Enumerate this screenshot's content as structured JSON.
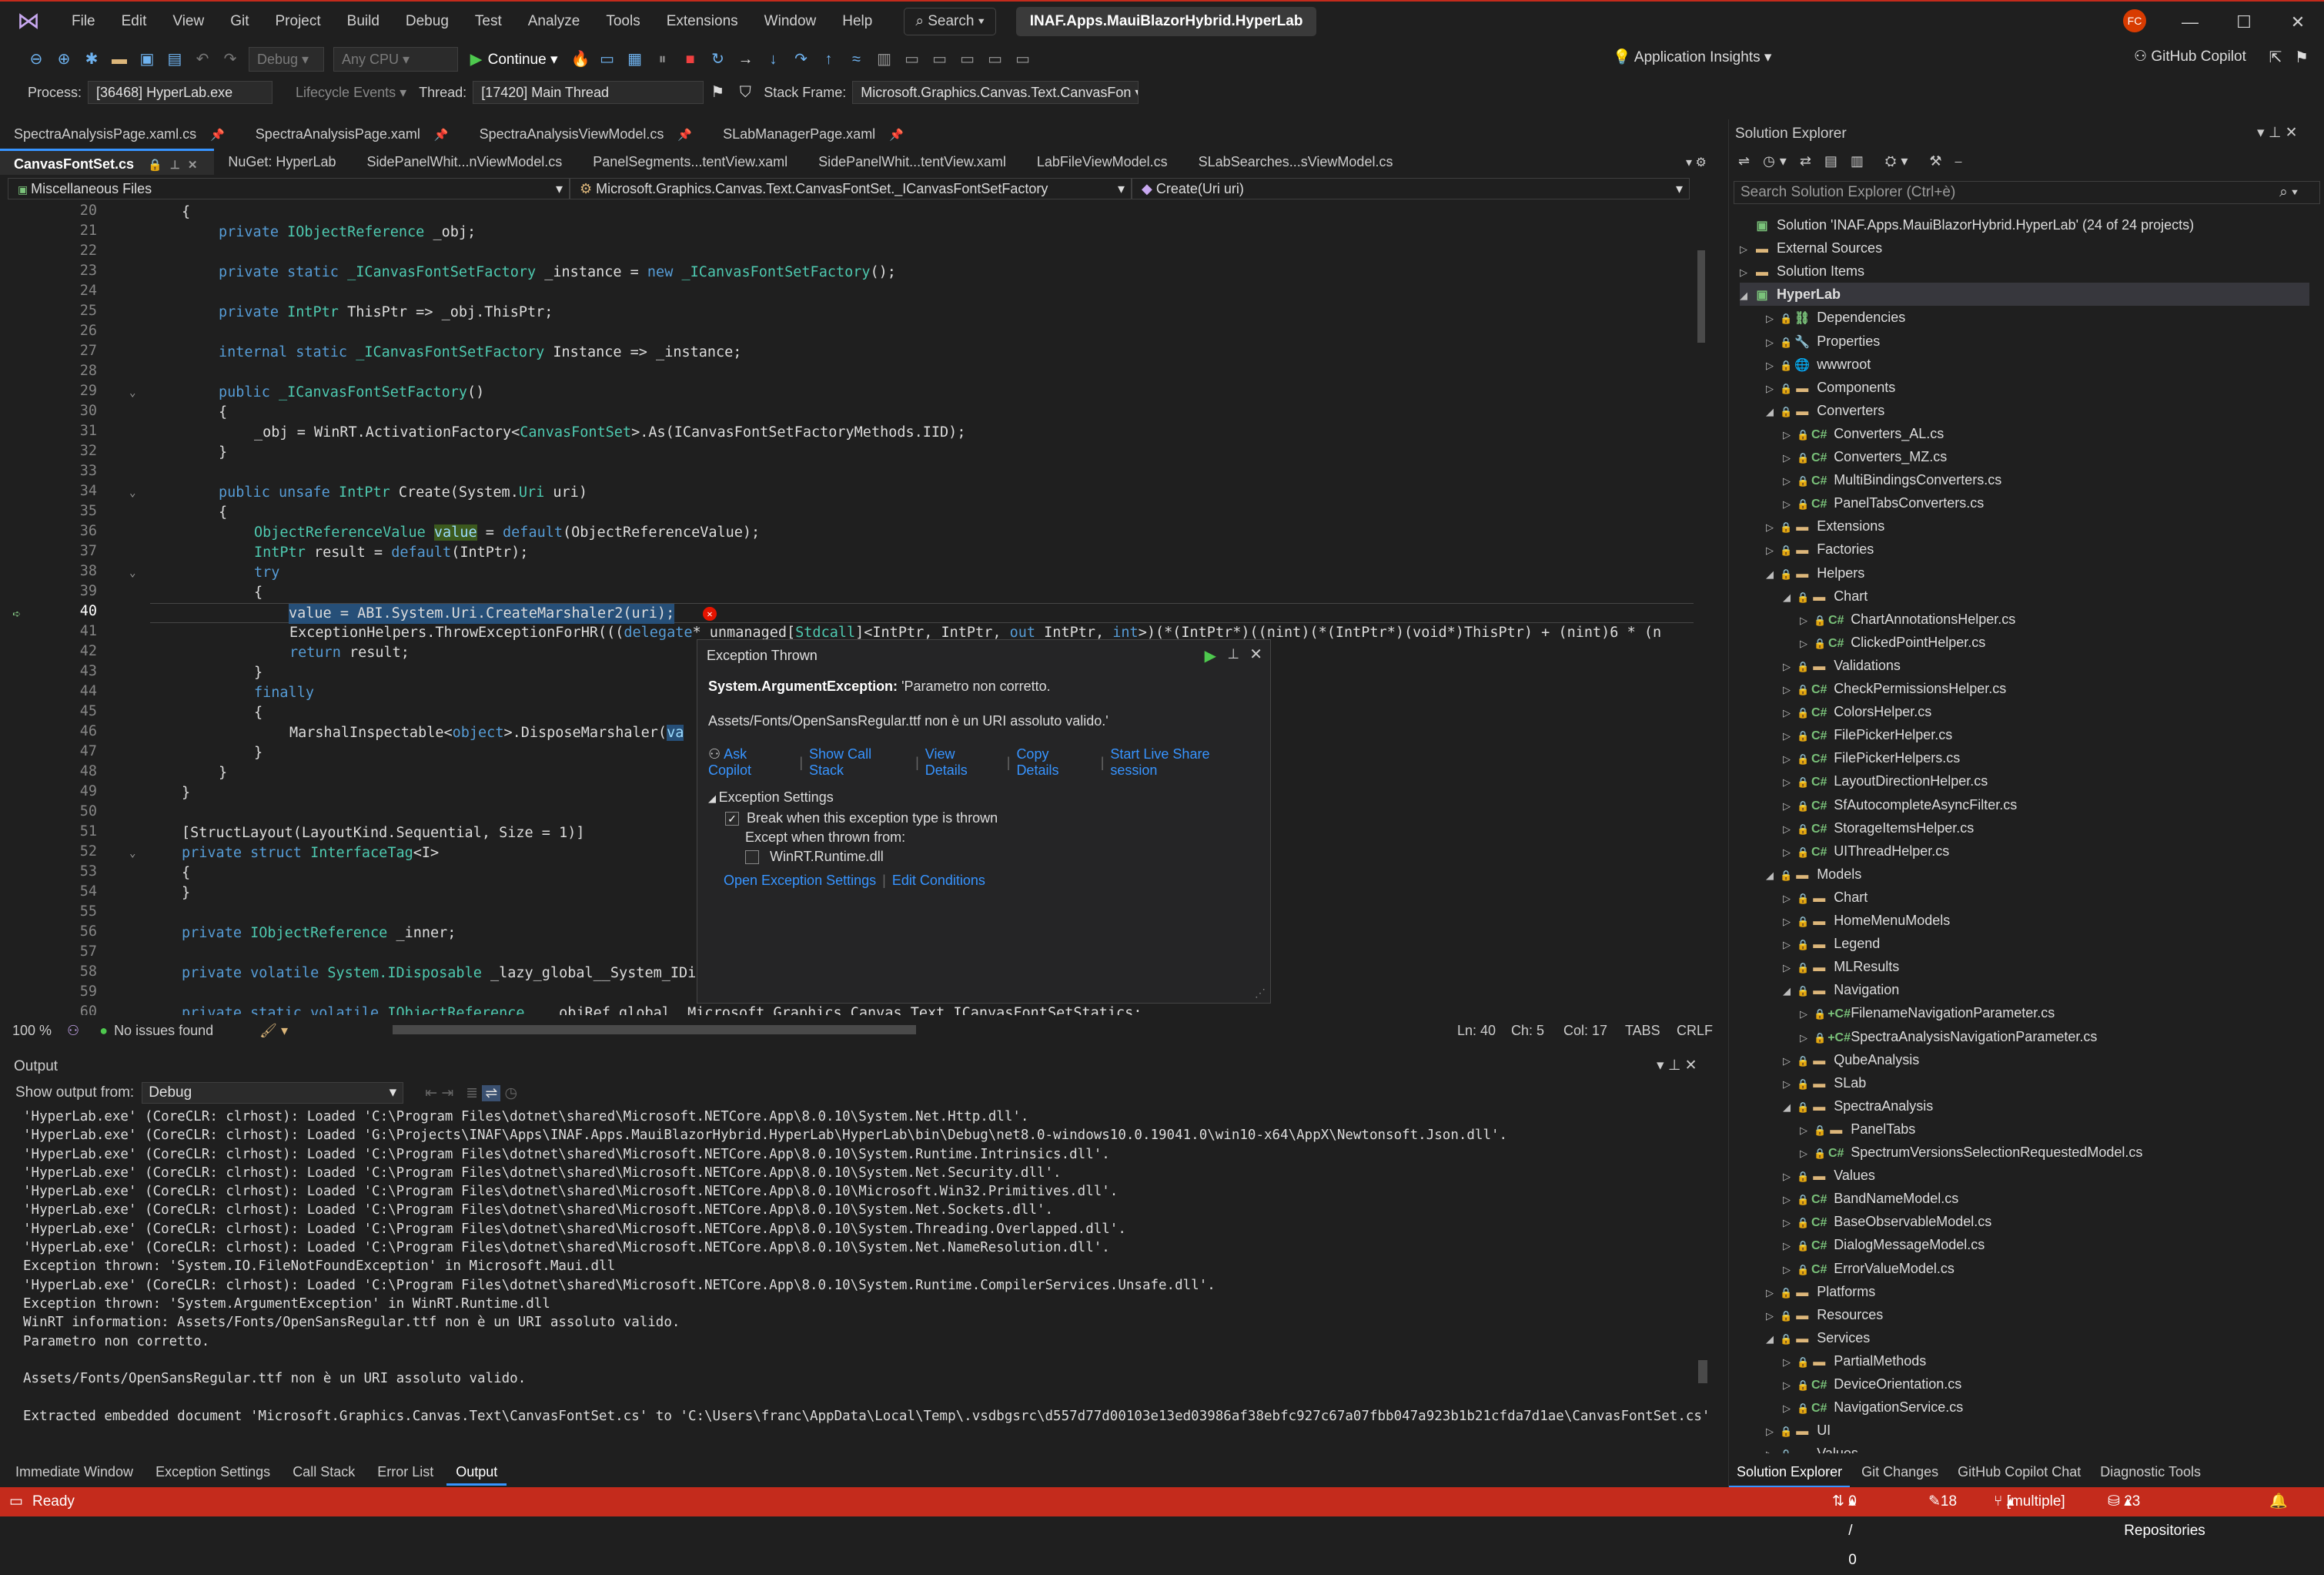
{
  "menu": {
    "items": [
      "File",
      "Edit",
      "View",
      "Git",
      "Project",
      "Build",
      "Debug",
      "Test",
      "Analyze",
      "Tools",
      "Extensions",
      "Window",
      "Help"
    ],
    "search": "Search",
    "solution_title": "INAF.Apps.MauiBlazorHybrid.HyperLab",
    "avatar": "FC"
  },
  "toolbar": {
    "config": "Debug",
    "platform": "Any CPU",
    "continue": "Continue",
    "app_insights": "Application Insights",
    "copilot": "GitHub Copilot"
  },
  "debugbar": {
    "process_label": "Process:",
    "process": "[36468] HyperLab.exe",
    "lifecycle": "Lifecycle Events",
    "thread_label": "Thread:",
    "thread": "[17420] Main Thread",
    "stack_label": "Stack Frame:",
    "stack": "Microsoft.Graphics.Canvas.Text.CanvasFon"
  },
  "tabs_row1": [
    "SpectraAnalysisPage.xaml.cs",
    "SpectraAnalysisPage.xaml",
    "SpectraAnalysisViewModel.cs",
    "SLabManagerPage.xaml"
  ],
  "tabs_row2": [
    "CanvasFontSet.cs",
    "NuGet: HyperLab",
    "SidePanelWhit...nViewModel.cs",
    "PanelSegments...tentView.xaml",
    "SidePanelWhit...tentView.xaml",
    "LabFileViewModel.cs",
    "SLabSearches...sViewModel.cs"
  ],
  "navbar": {
    "project": "Miscellaneous Files",
    "type": "Microsoft.Graphics.Canvas.Text.CanvasFontSet._ICanvasFontSetFactory",
    "member": "Create(Uri uri)"
  },
  "code": {
    "l20": "{",
    "l21a": "private ",
    "l21b": "IObjectReference",
    "l21c": " _obj;",
    "l23a": "private static ",
    "l23b": "_ICanvasFontSetFactory",
    "l23c": " _instance = ",
    "l23d": "new ",
    "l23e": "_ICanvasFontSetFactory",
    "l23f": "();",
    "l25a": "private ",
    "l25b": "IntPtr",
    "l25c": " ThisPtr => _obj.ThisPtr;",
    "l27a": "internal static ",
    "l27b": "_ICanvasFontSetFactory",
    "l27c": " Instance => _instance;",
    "l29a": "public ",
    "l29b": "_ICanvasFontSetFactory",
    "l29c": "()",
    "l30": "{",
    "l31a": "_obj = WinRT.ActivationFactory<",
    "l31b": "CanvasFontSet",
    "l31c": ">.As(ICanvasFontSetFactoryMethods.IID);",
    "l32": "}",
    "l34a": "public unsafe ",
    "l34b": "IntPtr",
    "l34c": " Create(System.",
    "l34d": "Uri",
    "l34e": " uri)",
    "l35": "{",
    "l36a": "ObjectReferenceValue ",
    "l36b": "value",
    "l36c": " = ",
    "l36d": "default",
    "l36e": "(ObjectReferenceValue);",
    "l37a": "IntPtr",
    "l37b": " result = ",
    "l37c": "default",
    "l37d": "(IntPtr);",
    "l38": "try",
    "l39": "{",
    "l40": "value = ABI.System.Uri.CreateMarshaler2(uri);",
    "l41a": "ExceptionHelpers.ThrowExceptionForHR(((",
    "l41b": "delegate",
    "l41c": "* unmanaged[",
    "l41d": "Stdcall",
    "l41e": "]<IntPtr, IntPtr, ",
    "l41f": "out",
    "l41g": " IntPtr, ",
    "l41h": "int",
    "l41i": ">)(*(IntPtr*)((nint)(*(IntPtr*)(void*)ThisPtr) + (nint)6 * (n",
    "l42a": "return ",
    "l42b": "result;",
    "l43": "}",
    "l44": "finally",
    "l45": "{",
    "l46a": "MarshalInspectable<",
    "l46b": "object",
    "l46c": ">.DisposeMarshaler(",
    "l46d": "va",
    "l47": "}",
    "l48": "}",
    "l49": "}",
    "l51a": "[StructLayout(LayoutKind.Sequential, Size = 1)]",
    "l52a": "private struct ",
    "l52b": "InterfaceTag",
    "l52c": "<I>",
    "l53": "{",
    "l54": "}",
    "l56a": "private ",
    "l56b": "IObjectReference",
    "l56c": " _inner;",
    "l58a": "private volatile ",
    "l58b": "System.IDisposable",
    "l58c": " _lazy_global__System_IDisposable;",
    "l60a": "private static volatile ",
    "l60b": "IObjectReference",
    "l60c": " ___objRef_global__Microsoft_Graphics_Canvas_Text_ICanvasFontSetStatics;"
  },
  "line_numbers": [
    "20",
    "21",
    "22",
    "23",
    "24",
    "25",
    "26",
    "27",
    "28",
    "29",
    "30",
    "31",
    "32",
    "33",
    "34",
    "35",
    "36",
    "37",
    "38",
    "39",
    "40",
    "41",
    "42",
    "43",
    "44",
    "45",
    "46",
    "47",
    "48",
    "49",
    "50",
    "51",
    "52",
    "53",
    "54",
    "55",
    "56",
    "57",
    "58",
    "59",
    "60"
  ],
  "popup": {
    "title": "Exception Thrown",
    "exception_type": "System.ArgumentException:",
    "exception_msg": "'Parametro non corretto.",
    "detail": "Assets/Fonts/OpenSansRegular.ttf non è un URI assoluto valido.'",
    "ask_copilot": "Ask Copilot",
    "show_call_stack": "Show Call Stack",
    "view_details": "View Details",
    "copy_details": "Copy Details",
    "live_share": "Start Live Share session",
    "settings_header": "Exception Settings",
    "break_when": "Break when this exception type is thrown",
    "except_when": "Except when thrown from:",
    "winrt": "WinRT.Runtime.dll",
    "open_settings": "Open Exception Settings",
    "edit_conditions": "Edit Conditions"
  },
  "editor_status": {
    "zoom": "100 %",
    "issues": "No issues found",
    "ln": "Ln: 40",
    "ch": "Ch: 5",
    "col": "Col: 17",
    "tabs": "TABS",
    "crlf": "CRLF"
  },
  "output": {
    "title": "Output",
    "show_from": "Show output from:",
    "source": "Debug",
    "lines": [
      "'HyperLab.exe' (CoreCLR: clrhost): Loaded 'C:\\Program Files\\dotnet\\shared\\Microsoft.NETCore.App\\8.0.10\\System.Net.Http.dll'.",
      "'HyperLab.exe' (CoreCLR: clrhost): Loaded 'G:\\Projects\\INAF\\Apps\\INAF.Apps.MauiBlazorHybrid.HyperLab\\HyperLab\\bin\\Debug\\net8.0-windows10.0.19041.0\\win10-x64\\AppX\\Newtonsoft.Json.dll'.",
      "'HyperLab.exe' (CoreCLR: clrhost): Loaded 'C:\\Program Files\\dotnet\\shared\\Microsoft.NETCore.App\\8.0.10\\System.Runtime.Intrinsics.dll'.",
      "'HyperLab.exe' (CoreCLR: clrhost): Loaded 'C:\\Program Files\\dotnet\\shared\\Microsoft.NETCore.App\\8.0.10\\System.Net.Security.dll'.",
      "'HyperLab.exe' (CoreCLR: clrhost): Loaded 'C:\\Program Files\\dotnet\\shared\\Microsoft.NETCore.App\\8.0.10\\Microsoft.Win32.Primitives.dll'.",
      "'HyperLab.exe' (CoreCLR: clrhost): Loaded 'C:\\Program Files\\dotnet\\shared\\Microsoft.NETCore.App\\8.0.10\\System.Net.Sockets.dll'.",
      "'HyperLab.exe' (CoreCLR: clrhost): Loaded 'C:\\Program Files\\dotnet\\shared\\Microsoft.NETCore.App\\8.0.10\\System.Threading.Overlapped.dll'.",
      "'HyperLab.exe' (CoreCLR: clrhost): Loaded 'C:\\Program Files\\dotnet\\shared\\Microsoft.NETCore.App\\8.0.10\\System.Net.NameResolution.dll'.",
      "Exception thrown: 'System.IO.FileNotFoundException' in Microsoft.Maui.dll",
      "'HyperLab.exe' (CoreCLR: clrhost): Loaded 'C:\\Program Files\\dotnet\\shared\\Microsoft.NETCore.App\\8.0.10\\System.Runtime.CompilerServices.Unsafe.dll'.",
      "Exception thrown: 'System.ArgumentException' in WinRT.Runtime.dll",
      "WinRT information: Assets/Fonts/OpenSansRegular.ttf non è un URI assoluto valido.",
      "Parametro non corretto.",
      "",
      "Assets/Fonts/OpenSansRegular.ttf non è un URI assoluto valido.",
      "",
      "Extracted embedded document 'Microsoft.Graphics.Canvas.Text\\CanvasFontSet.cs' to 'C:\\Users\\franc\\AppData\\Local\\Temp\\.vsdbgsrc\\d557d77d00103e13ed03986af38ebfc927c67a07fbb047a923b1b21cfda7d1ae\\CanvasFontSet.cs'"
    ]
  },
  "bottom_tabs": [
    "Immediate Window",
    "Exception Settings",
    "Call Stack",
    "Error List",
    "Output"
  ],
  "solution": {
    "title": "Solution Explorer",
    "search_placeholder": "Search Solution Explorer (Ctrl+è)",
    "items": [
      {
        "t": "Solution 'INAF.Apps.MauiBlazorHybrid.HyperLab' (24 of 24 projects)",
        "d": 0,
        "k": "sol",
        "a": ""
      },
      {
        "t": "External Sources",
        "d": 0,
        "k": "folder",
        "a": "▷"
      },
      {
        "t": "Solution Items",
        "d": 0,
        "k": "folder",
        "a": "▷"
      },
      {
        "t": "HyperLab",
        "d": 0,
        "k": "proj",
        "a": "◢"
      },
      {
        "t": "Dependencies",
        "d": 1,
        "k": "dep",
        "a": "▷"
      },
      {
        "t": "Properties",
        "d": 1,
        "k": "prop",
        "a": "▷"
      },
      {
        "t": "wwwroot",
        "d": 1,
        "k": "globe",
        "a": "▷"
      },
      {
        "t": "Components",
        "d": 1,
        "k": "folder",
        "a": "▷"
      },
      {
        "t": "Converters",
        "d": 1,
        "k": "folder",
        "a": "◢"
      },
      {
        "t": "Converters_AL.cs",
        "d": 2,
        "k": "cs",
        "a": "▷"
      },
      {
        "t": "Converters_MZ.cs",
        "d": 2,
        "k": "cs",
        "a": "▷"
      },
      {
        "t": "MultiBindingsConverters.cs",
        "d": 2,
        "k": "cs",
        "a": "▷"
      },
      {
        "t": "PanelTabsConverters.cs",
        "d": 2,
        "k": "cs",
        "a": "▷"
      },
      {
        "t": "Extensions",
        "d": 1,
        "k": "folder",
        "a": "▷"
      },
      {
        "t": "Factories",
        "d": 1,
        "k": "folder",
        "a": "▷"
      },
      {
        "t": "Helpers",
        "d": 1,
        "k": "folder",
        "a": "◢"
      },
      {
        "t": "Chart",
        "d": 2,
        "k": "folder",
        "a": "◢"
      },
      {
        "t": "ChartAnnotationsHelper.cs",
        "d": 3,
        "k": "cs",
        "a": "▷"
      },
      {
        "t": "ClickedPointHelper.cs",
        "d": 3,
        "k": "cs",
        "a": "▷"
      },
      {
        "t": "Validations",
        "d": 2,
        "k": "folder",
        "a": "▷"
      },
      {
        "t": "CheckPermissionsHelper.cs",
        "d": 2,
        "k": "cs",
        "a": "▷"
      },
      {
        "t": "ColorsHelper.cs",
        "d": 2,
        "k": "cs",
        "a": "▷"
      },
      {
        "t": "FilePickerHelper.cs",
        "d": 2,
        "k": "cs",
        "a": "▷"
      },
      {
        "t": "FilePickerHelpers.cs",
        "d": 2,
        "k": "cs",
        "a": "▷"
      },
      {
        "t": "LayoutDirectionHelper.cs",
        "d": 2,
        "k": "cs",
        "a": "▷"
      },
      {
        "t": "SfAutocompleteAsyncFilter.cs",
        "d": 2,
        "k": "cs",
        "a": "▷"
      },
      {
        "t": "StorageItemsHelper.cs",
        "d": 2,
        "k": "cs",
        "a": "▷"
      },
      {
        "t": "UIThreadHelper.cs",
        "d": 2,
        "k": "cs",
        "a": "▷"
      },
      {
        "t": "Models",
        "d": 1,
        "k": "folder",
        "a": "◢"
      },
      {
        "t": "Chart",
        "d": 2,
        "k": "folder",
        "a": "▷"
      },
      {
        "t": "HomeMenuModels",
        "d": 2,
        "k": "folder",
        "a": "▷"
      },
      {
        "t": "Legend",
        "d": 2,
        "k": "folder",
        "a": "▷"
      },
      {
        "t": "MLResults",
        "d": 2,
        "k": "folder",
        "a": "▷"
      },
      {
        "t": "Navigation",
        "d": 2,
        "k": "folder",
        "a": "◢"
      },
      {
        "t": "FilenameNavigationParameter.cs",
        "d": 3,
        "k": "csplus",
        "a": "▷"
      },
      {
        "t": "SpectraAnalysisNavigationParameter.cs",
        "d": 3,
        "k": "csplus",
        "a": "▷"
      },
      {
        "t": "QubeAnalysis",
        "d": 2,
        "k": "folder",
        "a": "▷"
      },
      {
        "t": "SLab",
        "d": 2,
        "k": "folder",
        "a": "▷"
      },
      {
        "t": "SpectraAnalysis",
        "d": 2,
        "k": "folder",
        "a": "◢"
      },
      {
        "t": "PanelTabs",
        "d": 3,
        "k": "folder",
        "a": "▷"
      },
      {
        "t": "SpectrumVersionsSelectionRequestedModel.cs",
        "d": 3,
        "k": "cs",
        "a": "▷"
      },
      {
        "t": "Values",
        "d": 2,
        "k": "folder",
        "a": "▷"
      },
      {
        "t": "BandNameModel.cs",
        "d": 2,
        "k": "cs",
        "a": "▷"
      },
      {
        "t": "BaseObservableModel.cs",
        "d": 2,
        "k": "cs",
        "a": "▷"
      },
      {
        "t": "DialogMessageModel.cs",
        "d": 2,
        "k": "cs",
        "a": "▷"
      },
      {
        "t": "ErrorValueModel.cs",
        "d": 2,
        "k": "cs",
        "a": "▷"
      },
      {
        "t": "Platforms",
        "d": 1,
        "k": "folder",
        "a": "▷"
      },
      {
        "t": "Resources",
        "d": 1,
        "k": "folder",
        "a": "▷"
      },
      {
        "t": "Services",
        "d": 1,
        "k": "folder",
        "a": "◢"
      },
      {
        "t": "PartialMethods",
        "d": 2,
        "k": "folder",
        "a": "▷"
      },
      {
        "t": "DeviceOrientation.cs",
        "d": 2,
        "k": "cs",
        "a": "▷"
      },
      {
        "t": "NavigationService.cs",
        "d": 2,
        "k": "cs",
        "a": "▷"
      },
      {
        "t": "UI",
        "d": 1,
        "k": "folder",
        "a": "▷"
      },
      {
        "t": "Values",
        "d": 1,
        "k": "folder",
        "a": "▷"
      }
    ]
  },
  "right_tabs": [
    "Solution Explorer",
    "Git Changes",
    "GitHub Copilot Chat",
    "Diagnostic Tools"
  ],
  "status": {
    "ready": "Ready",
    "updown": "0 / 0",
    "edits": "18",
    "branch": "[multiple]",
    "repos": "23 Repositories"
  },
  "colors": {
    "accent": "#3794ff",
    "status": "#c42b1c",
    "keyword": "#569cd6",
    "type": "#4ec9b0"
  }
}
